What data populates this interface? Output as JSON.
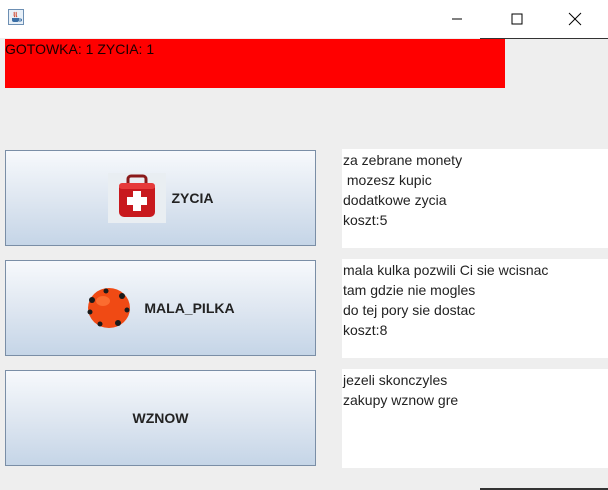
{
  "window": {
    "title": "",
    "minimize_icon": "minimize-icon",
    "maximize_icon": "maximize-icon",
    "close_icon": "close-icon"
  },
  "status": {
    "text": "GOTOWKA: 1 ZYCIA: 1"
  },
  "shop": [
    {
      "label": "ZYCIA",
      "icon": "first-aid-kit-icon",
      "description": [
        "za zebrane monety",
        " mozesz kupic",
        "dodatkowe zycia",
        "koszt:5"
      ]
    },
    {
      "label": "MALA_PILKA",
      "icon": "red-ball-icon",
      "description": [
        "mala kulka pozwili Ci sie wcisnac",
        "tam gdzie nie mogles",
        "do tej pory sie dostac",
        "koszt:8"
      ]
    },
    {
      "label": "WZNOW",
      "icon": "",
      "description": [
        "jezeli skonczyles",
        "zakupy wznow gre"
      ]
    }
  ],
  "colors": {
    "status_bg": "#ff0000",
    "window_bg": "#eeeeee",
    "button_border": "#7a8ea6"
  }
}
